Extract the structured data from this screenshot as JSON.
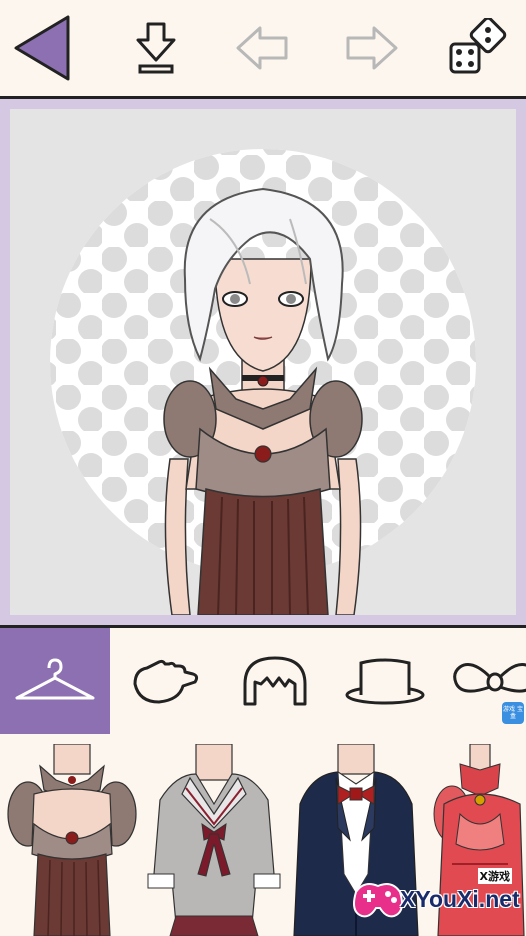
{
  "toolbar": {
    "back_icon": "back-triangle-icon",
    "save_icon": "download-icon",
    "undo_icon": "undo-arrow-icon",
    "redo_icon": "redo-arrow-icon",
    "random_icon": "dice-icon"
  },
  "tabs": [
    {
      "icon": "hanger-icon",
      "active": true
    },
    {
      "icon": "hand-icon",
      "active": false
    },
    {
      "icon": "hair-icon",
      "active": false
    },
    {
      "icon": "hat-icon",
      "active": false
    },
    {
      "icon": "bow-icon",
      "active": false
    }
  ],
  "colors": {
    "accent": "#8c70b2",
    "stage_border": "#d5c8e2",
    "background": "#fdf6ee",
    "canvas": "#e4e4e4"
  },
  "items": [
    {
      "name": "brown-corset-top"
    },
    {
      "name": "school-sailor-uniform"
    },
    {
      "name": "navy-blazer-bowtie"
    },
    {
      "name": "red-qipao-top"
    }
  ],
  "watermark": {
    "small": "X游戏",
    "text": "XYouXi.net",
    "badge": "游戏\n宝盒"
  }
}
